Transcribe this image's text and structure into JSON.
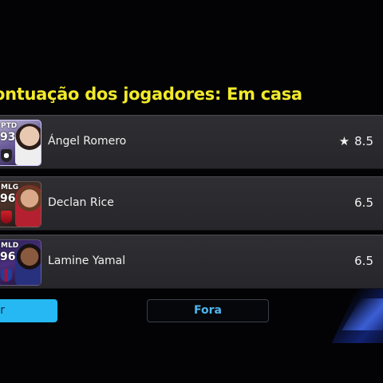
{
  "header": {
    "title": "ontuação dos jogadores: Em casa"
  },
  "players": [
    {
      "position": "PTD",
      "rating": "93",
      "name": "Ángel Romero",
      "score": "8.5",
      "star": "★"
    },
    {
      "position": "MLG",
      "rating": "96",
      "name": "Declan Rice",
      "score": "6.5",
      "star": ""
    },
    {
      "position": "MLD",
      "rating": "96",
      "name": "Lamine Yamal",
      "score": "6.5",
      "star": ""
    }
  ],
  "tabs": {
    "left_label": "r",
    "away_label": "Fora"
  },
  "colors": {
    "title": "#f2ea2a",
    "active_tab": "#25b8f2",
    "inactive_tab_text": "#4fb6ee"
  }
}
